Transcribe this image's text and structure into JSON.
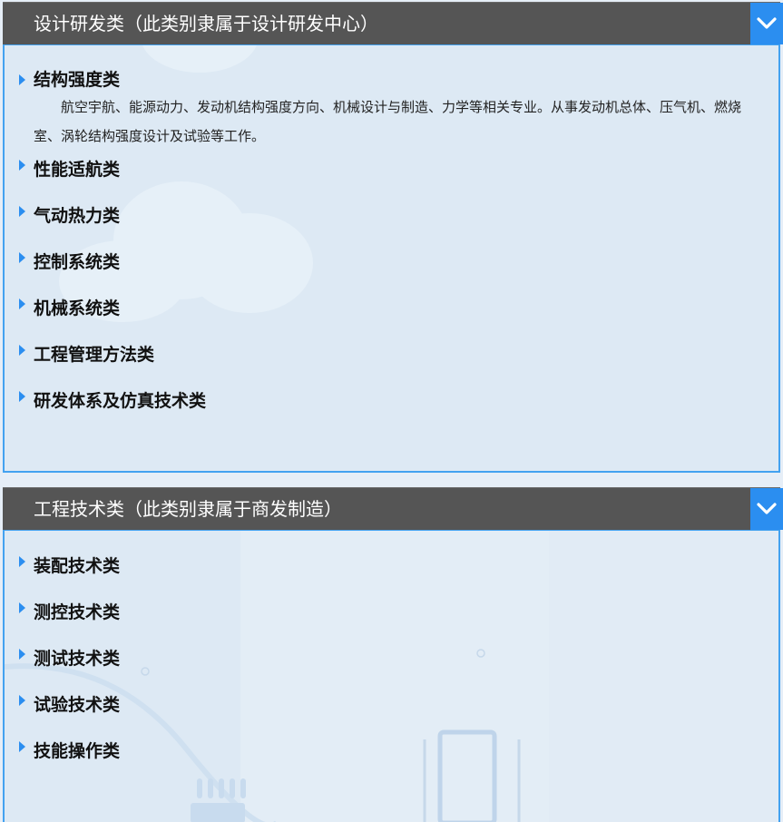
{
  "panels": [
    {
      "title": "设计研发类（此类别隶属于设计研发中心）",
      "items": [
        {
          "label": "结构强度类",
          "description": "航空宇航、能源动力、发动机结构强度方向、机械设计与制造、力学等相关专业。从事发动机总体、压气机、燃烧室、涡轮结构强度设计及试验等工作。"
        },
        {
          "label": "性能适航类"
        },
        {
          "label": "气动热力类"
        },
        {
          "label": "控制系统类"
        },
        {
          "label": "机械系统类"
        },
        {
          "label": "工程管理方法类"
        },
        {
          "label": "研发体系及仿真技术类"
        }
      ]
    },
    {
      "title": "工程技术类（此类别隶属于商发制造）",
      "items": [
        {
          "label": "装配技术类"
        },
        {
          "label": "测控技术类"
        },
        {
          "label": "测试技术类"
        },
        {
          "label": "试验技术类"
        },
        {
          "label": "技能操作类"
        }
      ]
    }
  ],
  "icons": {
    "toggle": "chevron-down-icon",
    "bullet": "triangle-right-icon"
  },
  "colors": {
    "header_bg": "#555555",
    "accent": "#2b8ef0",
    "panel_border": "#43a2f0",
    "panel_bg": "#dde9f4"
  }
}
